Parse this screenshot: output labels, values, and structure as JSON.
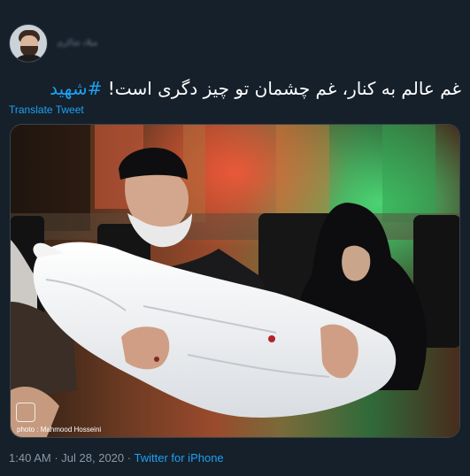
{
  "author": {
    "avatar_icon": "profile-photo",
    "name": "میلاد شاکری"
  },
  "tweet": {
    "text": "غم عالم به کنار، غم چشمان تو چیز دگری است!",
    "hashtag": "#شهید",
    "translate_label": "Translate Tweet"
  },
  "photo": {
    "credit": "photo : Mahmood Hosseini"
  },
  "meta": {
    "time": "1:40 AM",
    "date": "Jul 28, 2020",
    "separator": "·",
    "source": "Twitter for iPhone"
  },
  "colors": {
    "background": "#15202b",
    "link": "#1da1f2",
    "secondary_text": "#8899a6"
  }
}
